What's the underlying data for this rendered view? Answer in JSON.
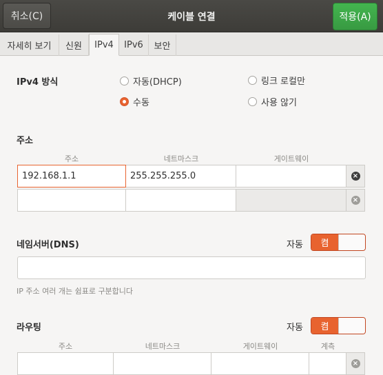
{
  "header": {
    "cancel_label": "취소(C)",
    "title": "케이블 연결",
    "apply_label": "적용(A)"
  },
  "tabs": [
    {
      "label": "자세히 보기"
    },
    {
      "label": "신원"
    },
    {
      "label": "IPv4"
    },
    {
      "label": "IPv6"
    },
    {
      "label": "보안"
    }
  ],
  "ipv4_method": {
    "title": "IPv4 방식",
    "options": [
      {
        "label": "자동(DHCP)",
        "checked": false
      },
      {
        "label": "링크 로컬만",
        "checked": false
      },
      {
        "label": "수동",
        "checked": true
      },
      {
        "label": "사용 않기",
        "checked": false
      }
    ]
  },
  "addresses": {
    "title": "주소",
    "columns": [
      "주소",
      "네트마스크",
      "게이트웨이"
    ],
    "rows": [
      {
        "address": "192.168.1.1",
        "netmask": "255.255.255.0",
        "gateway": ""
      },
      {
        "address": "",
        "netmask": "",
        "gateway": ""
      }
    ]
  },
  "dns": {
    "title": "네임서버(DNS)",
    "auto_label": "자동",
    "switch_label": "켬",
    "value": "",
    "hint": "IP 주소 여러 개는 쉼표로 구분합니다"
  },
  "routes": {
    "title": "라우팅",
    "auto_label": "자동",
    "switch_label": "켬",
    "columns": [
      "주소",
      "네트마스크",
      "게이트웨이",
      "계측"
    ]
  },
  "icons": {
    "delete": "clear-circle-icon"
  },
  "colors": {
    "accent": "#e8632f",
    "apply": "#3ea849",
    "header": "#43423e"
  }
}
